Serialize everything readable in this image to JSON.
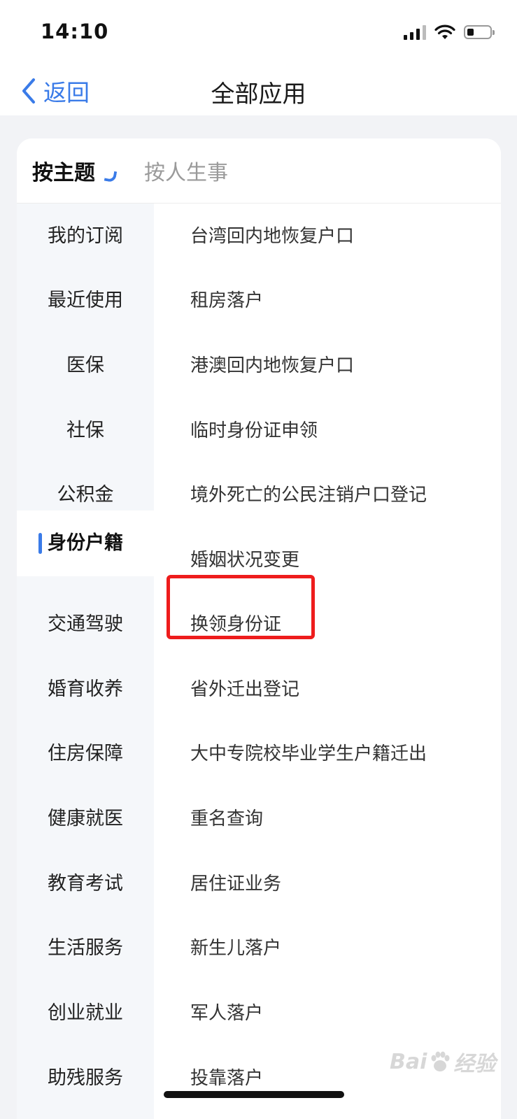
{
  "status_bar": {
    "time": "14:10",
    "icons": [
      "signal-icon",
      "wifi-icon",
      "battery-icon"
    ]
  },
  "nav": {
    "back_label": "返回",
    "title": "全部应用"
  },
  "tabs": [
    {
      "label": "按主题",
      "active": true
    },
    {
      "label": "按人生事",
      "active": false
    }
  ],
  "sidebar": {
    "items": [
      {
        "label": "我的订阅"
      },
      {
        "label": "最近使用"
      },
      {
        "label": "医保"
      },
      {
        "label": "社保"
      },
      {
        "label": "公积金"
      },
      {
        "label": "身份户籍",
        "active": true
      },
      {
        "label": "交通驾驶"
      },
      {
        "label": "婚育收养"
      },
      {
        "label": "住房保障"
      },
      {
        "label": "健康就医"
      },
      {
        "label": "教育考试"
      },
      {
        "label": "生活服务"
      },
      {
        "label": "创业就业"
      },
      {
        "label": "助残服务"
      }
    ]
  },
  "services": [
    {
      "label": "台湾回内地恢复户口"
    },
    {
      "label": "租房落户"
    },
    {
      "label": "港澳回内地恢复户口"
    },
    {
      "label": "临时身份证申领"
    },
    {
      "label": "境外死亡的公民注销户口登记"
    },
    {
      "label": "婚姻状况变更"
    },
    {
      "label": "换领身份证",
      "highlighted": true
    },
    {
      "label": "省外迁出登记"
    },
    {
      "label": "大中专院校毕业学生户籍迁出"
    },
    {
      "label": "重名查询"
    },
    {
      "label": "居住证业务"
    },
    {
      "label": "新生儿落户"
    },
    {
      "label": "军人落户"
    },
    {
      "label": "投靠落户"
    }
  ],
  "watermark": {
    "left": "Bai",
    "right": "经验"
  },
  "colors": {
    "accent": "#3a7be8",
    "highlight_border": "#ee1c1c",
    "sidebar_bg": "#f5f7fa",
    "page_bg": "#f2f3f6"
  }
}
